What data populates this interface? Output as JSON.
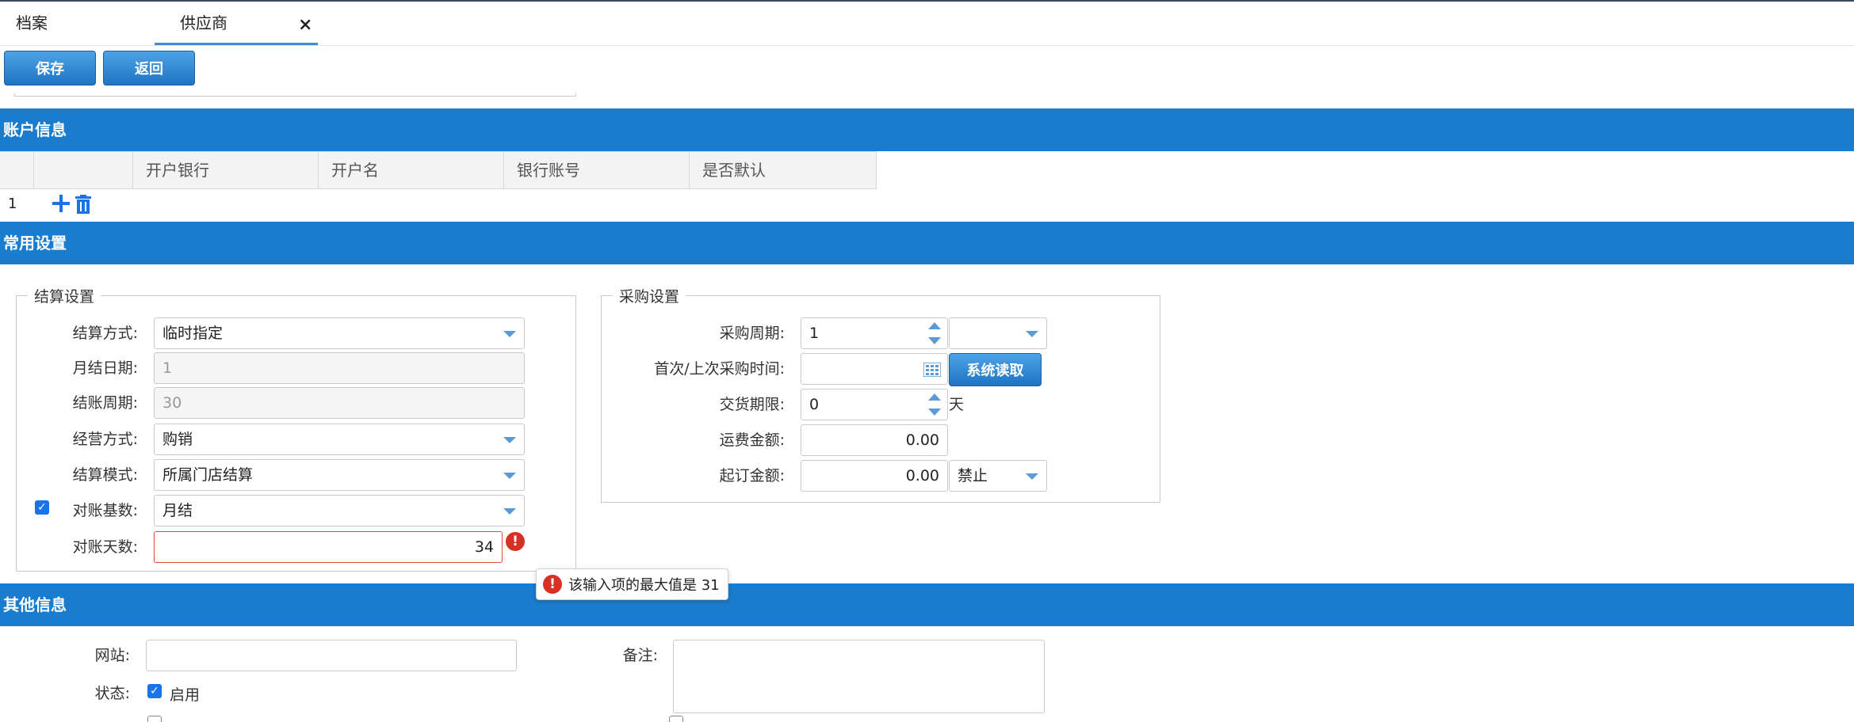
{
  "tabs": [
    {
      "label": "档案"
    },
    {
      "label": "供应商",
      "active": true,
      "close": "×"
    }
  ],
  "toolbar": {
    "save_label": "保存",
    "back_label": "返回"
  },
  "account": {
    "section_title": "账户信息",
    "columns": [
      "开户银行",
      "开户名",
      "银行账号",
      "是否默认"
    ],
    "row_index": "1"
  },
  "common": {
    "section_title": "常用设置",
    "settlement": {
      "legend": "结算设置",
      "method": {
        "label": "结算方式:",
        "value": "临时指定"
      },
      "month_day": {
        "label": "月结日期:",
        "value": "1"
      },
      "cycle": {
        "label": "结账周期:",
        "value": "30"
      },
      "business": {
        "label": "经营方式:",
        "value": "购销"
      },
      "mode": {
        "label": "结算模式:",
        "value": "所属门店结算"
      },
      "base": {
        "label": "对账基数:",
        "value": "月结",
        "checked": true
      },
      "days": {
        "label": "对账天数:",
        "value": "34"
      }
    },
    "purchase": {
      "legend": "采购设置",
      "period": {
        "label": "采购周期:",
        "value": "1"
      },
      "first_time": {
        "label": "首次/上次采购时间:",
        "value": ""
      },
      "read_button": "系统读取",
      "delivery": {
        "label": "交货期限:",
        "value": "0",
        "unit": "天"
      },
      "freight": {
        "label": "运费金额:",
        "value": "0.00"
      },
      "min_order": {
        "label": "起订金额:",
        "value": "0.00",
        "option": "禁止"
      }
    }
  },
  "validation": {
    "message": "该输入项的最大值是 31",
    "icon": "!"
  },
  "other": {
    "section_title": "其他信息",
    "website": {
      "label": "网站:",
      "value": ""
    },
    "remark": {
      "label": "备注:",
      "value": ""
    },
    "status": {
      "label": "状态:",
      "option": "启用",
      "checked": true
    }
  },
  "colors": {
    "section": "#1a7ccc",
    "error": "#d93025",
    "accent": "#3b8dd6"
  }
}
